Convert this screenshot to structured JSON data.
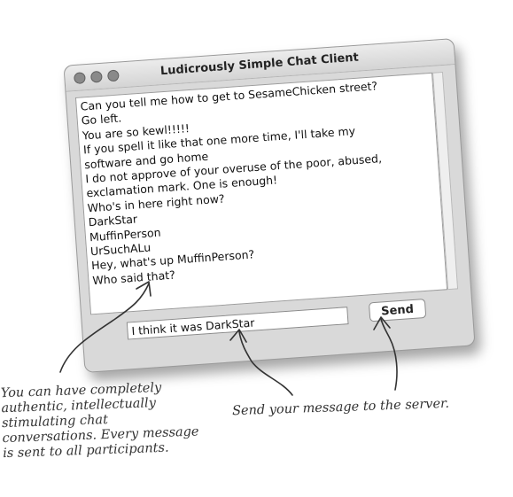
{
  "window": {
    "title": "Ludicrously Simple Chat Client"
  },
  "chat": {
    "lines": [
      "Can you tell me how to get to SesameChicken street?",
      "Go left.",
      "You are so kewl!!!!!",
      "If you spell it like that one more time, I'll take my",
      "software and go home",
      "I do not approve of your overuse of the poor, abused,",
      "exclamation mark. One is enough!",
      "Who's in here right now?",
      "DarkStar",
      "MuffinPerson",
      "UrSuchALu",
      "Hey, what's up MuffinPerson?",
      "Who said that?"
    ]
  },
  "input": {
    "value": "I think it was DarkStar"
  },
  "send_button": {
    "label": "Send"
  },
  "annotations": {
    "left_lines": [
      "You can have completely",
      "authentic, intellectually",
      "stimulating chat",
      "conversations. Every message",
      "is sent to all participants."
    ],
    "right": "Send your message to the server."
  }
}
